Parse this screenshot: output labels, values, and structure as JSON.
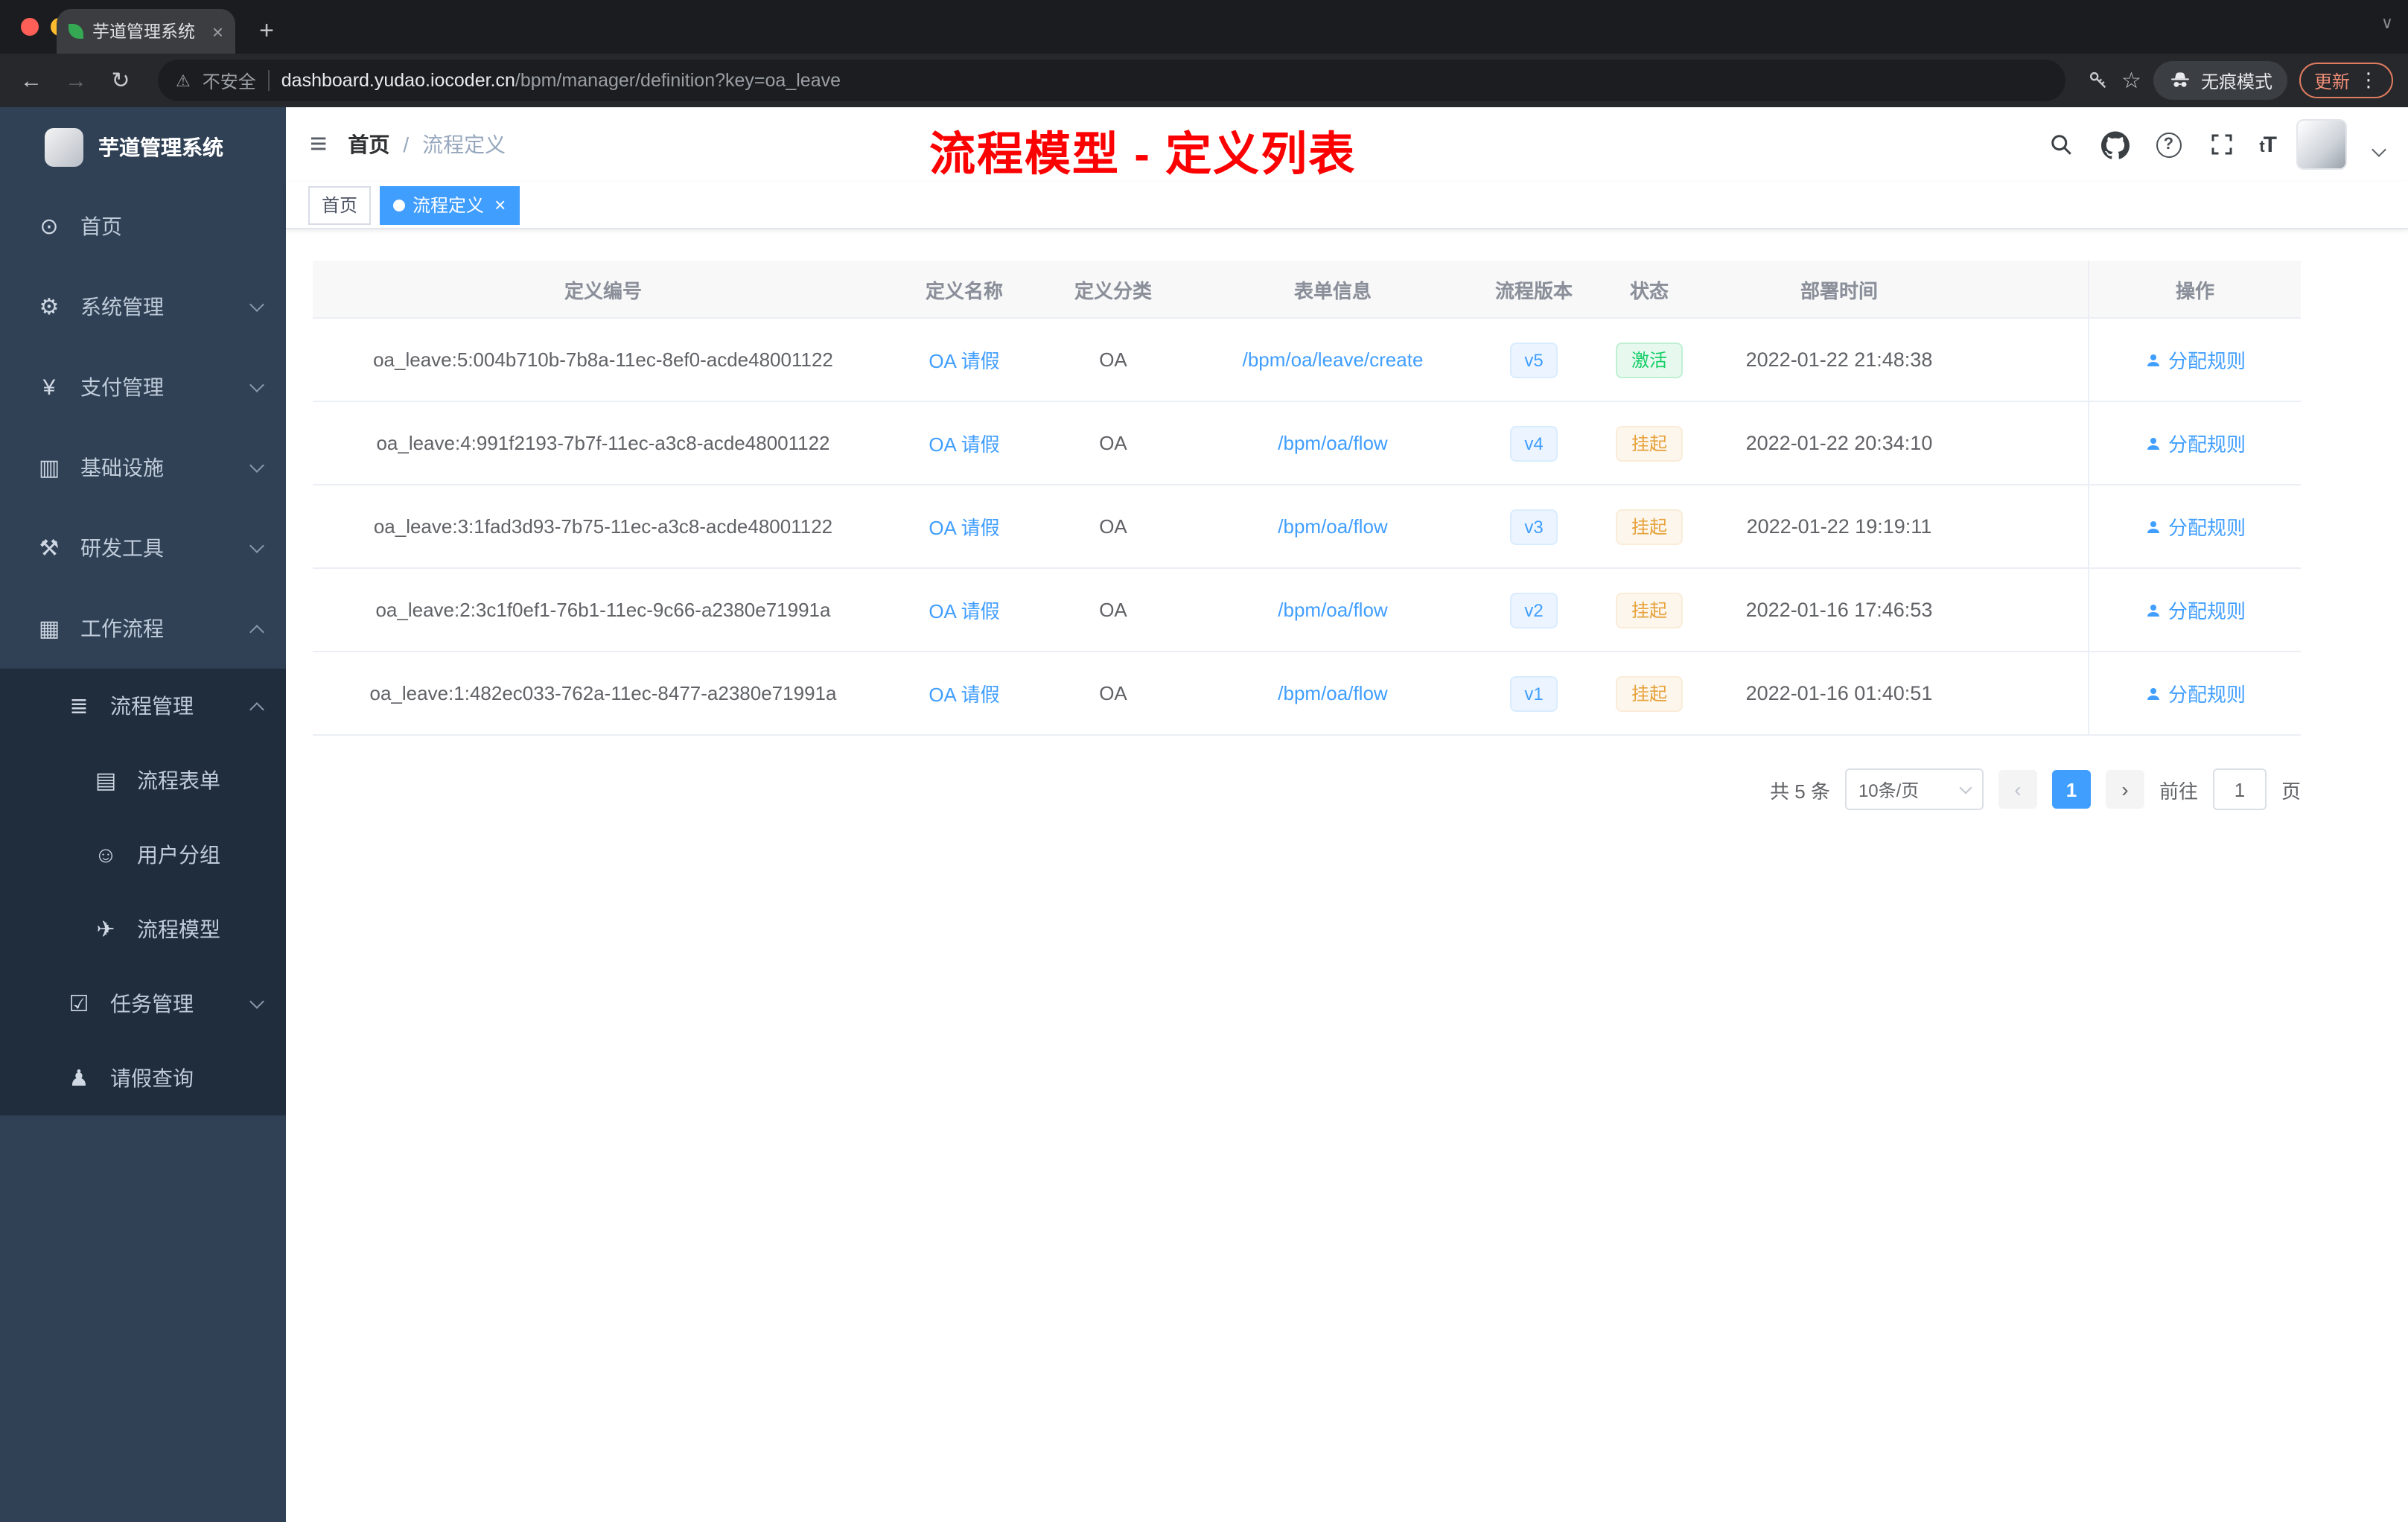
{
  "browser": {
    "tab_title": "芋道管理系统",
    "tab_close": "×",
    "new_tab": "+",
    "strip_caret": "∨",
    "back": "←",
    "forward": "→",
    "reload": "↻",
    "warn_icon": "⚠",
    "security_label": "不安全",
    "url_domain": "dashboard.yudao.iocoder.cn",
    "url_path": "/bpm/manager/definition?key=oa_leave",
    "star": "☆",
    "incognito_label": "无痕模式",
    "update_label": "更新",
    "menu_dots": "⋮"
  },
  "icons": {
    "dashboard": "⊙",
    "settings": "⚙",
    "payment": "¥",
    "infrastructure": "▥",
    "devtools": "⚒",
    "workflow": "▦",
    "process": "≣",
    "form": "▤",
    "usergroup": "☺",
    "model": "✈",
    "task": "☑",
    "user": "♟",
    "hamburger": "≡"
  },
  "sidebar": {
    "logo_title": "芋道管理系统",
    "items": [
      {
        "label": "首页"
      },
      {
        "label": "系统管理"
      },
      {
        "label": "支付管理"
      },
      {
        "label": "基础设施"
      },
      {
        "label": "研发工具"
      },
      {
        "label": "工作流程"
      },
      {
        "label": "流程管理"
      },
      {
        "label": "流程表单"
      },
      {
        "label": "用户分组"
      },
      {
        "label": "流程模型"
      },
      {
        "label": "任务管理"
      },
      {
        "label": "请假查询"
      }
    ]
  },
  "navbar": {
    "breadcrumb_home": "首页",
    "breadcrumb_sep": "/",
    "breadcrumb_current": "流程定义",
    "font_size_small": "t",
    "font_size_big": "T"
  },
  "annotation": "流程模型 - 定义列表",
  "tags": {
    "home": "首页",
    "active": "流程定义",
    "close": "×"
  },
  "table": {
    "columns": [
      "定义编号",
      "定义名称",
      "定义分类",
      "表单信息",
      "流程版本",
      "状态",
      "部署时间",
      "操作"
    ],
    "rows": [
      {
        "id": "oa_leave:5:004b710b-7b8a-11ec-8ef0-acde48001122",
        "name": "OA 请假",
        "category": "OA",
        "form": "/bpm/oa/leave/create",
        "version": "v5",
        "status": "激活",
        "time": "2022-01-22 21:48:38",
        "action": "分配规则"
      },
      {
        "id": "oa_leave:4:991f2193-7b7f-11ec-a3c8-acde48001122",
        "name": "OA 请假",
        "category": "OA",
        "form": "/bpm/oa/flow",
        "version": "v4",
        "status": "挂起",
        "time": "2022-01-22 20:34:10",
        "action": "分配规则"
      },
      {
        "id": "oa_leave:3:1fad3d93-7b75-11ec-a3c8-acde48001122",
        "name": "OA 请假",
        "category": "OA",
        "form": "/bpm/oa/flow",
        "version": "v3",
        "status": "挂起",
        "time": "2022-01-22 19:19:11",
        "action": "分配规则"
      },
      {
        "id": "oa_leave:2:3c1f0ef1-76b1-11ec-9c66-a2380e71991a",
        "name": "OA 请假",
        "category": "OA",
        "form": "/bpm/oa/flow",
        "version": "v2",
        "status": "挂起",
        "time": "2022-01-16 17:46:53",
        "action": "分配规则"
      },
      {
        "id": "oa_leave:1:482ec033-762a-11ec-8477-a2380e71991a",
        "name": "OA 请假",
        "category": "OA",
        "form": "/bpm/oa/flow",
        "version": "v1",
        "status": "挂起",
        "time": "2022-01-16 01:40:51",
        "action": "分配规则"
      }
    ]
  },
  "pagination": {
    "total": "共 5 条",
    "page_size": "10条/页",
    "prev": "‹",
    "page": "1",
    "next": "›",
    "goto_label": "前往",
    "goto_value": "1",
    "unit": "页"
  },
  "colors": {
    "primary": "#409eff",
    "success": "#13ce66",
    "warning": "#e6a23c",
    "annotation_red": "#fb0102",
    "sidebar_bg": "#304156",
    "submenu_bg": "#1f2d3d"
  }
}
